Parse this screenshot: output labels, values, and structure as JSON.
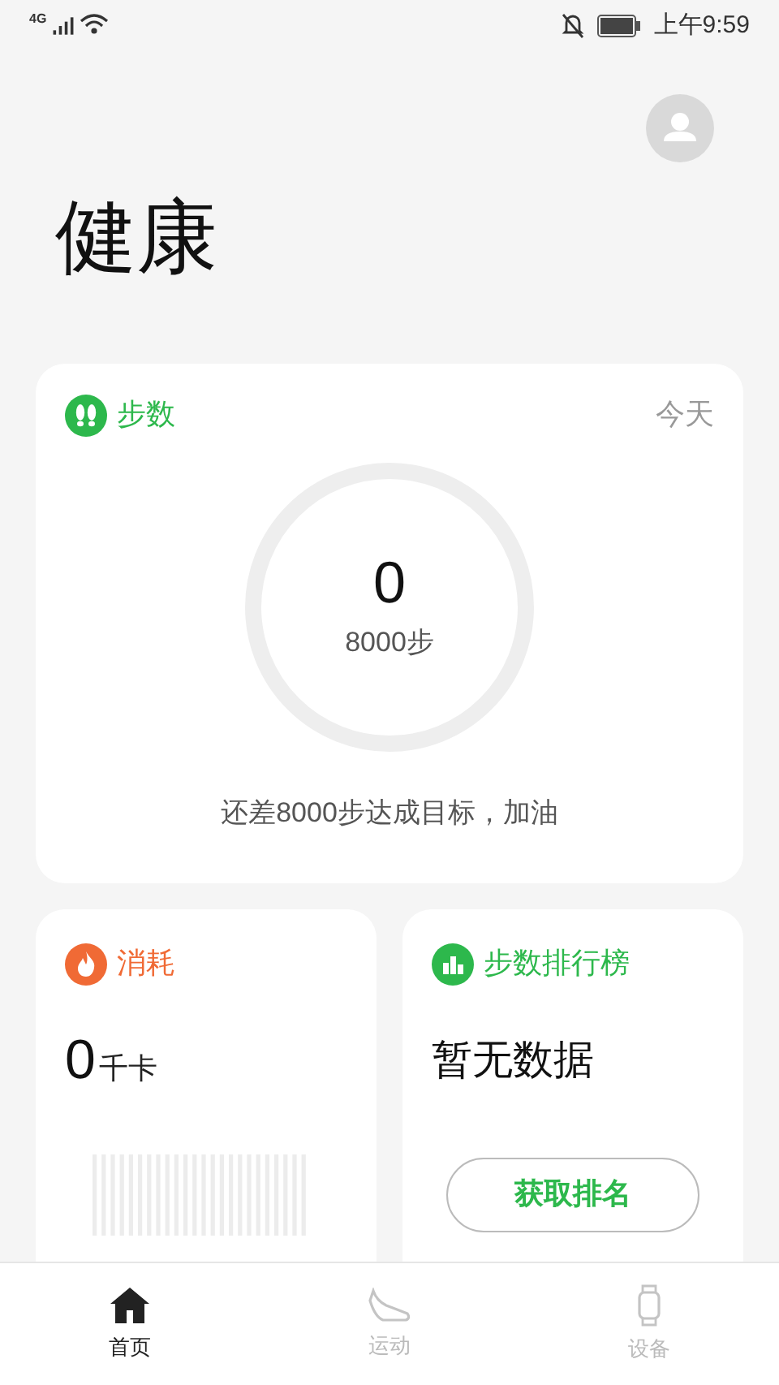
{
  "status_bar": {
    "network": "4G",
    "time": "上午9:59"
  },
  "title": "健康",
  "steps_card": {
    "title": "步数",
    "period": "今天",
    "count": "0",
    "goal": "8000步",
    "message": "还差8000步达成目标，加油"
  },
  "calorie_card": {
    "title": "消耗",
    "value": "0",
    "unit": "千卡"
  },
  "ranking_card": {
    "title": "步数排行榜",
    "message": "暂无数据",
    "button": "获取排名"
  },
  "tabs": [
    {
      "kind": "home",
      "label": "首页",
      "selected": true
    },
    {
      "kind": "sport",
      "label": "运动",
      "selected": false
    },
    {
      "kind": "device",
      "label": "设备",
      "selected": false
    }
  ]
}
